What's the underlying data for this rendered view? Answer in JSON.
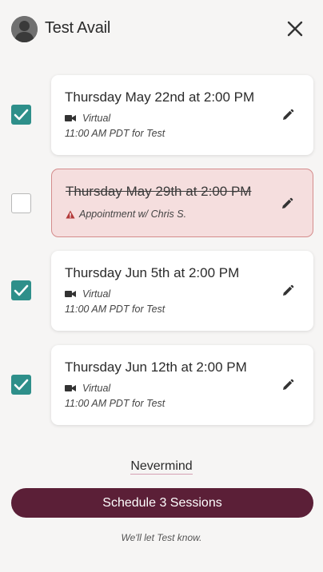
{
  "header": {
    "title": "Test Avail",
    "avatar_icon": "person-silhouette",
    "close_icon": "x"
  },
  "sessions": [
    {
      "title": "Thursday May 22nd at 2:00 PM",
      "checked": true,
      "conflict": false,
      "mode": "Virtual",
      "time_note": "11:00 AM PDT for Test"
    },
    {
      "title": "Thursday May 29th at 2:00 PM",
      "checked": false,
      "conflict": true,
      "conflict_text": "Appointment w/ Chris S."
    },
    {
      "title": "Thursday Jun 5th at 2:00 PM",
      "checked": true,
      "conflict": false,
      "mode": "Virtual",
      "time_note": "11:00 AM PDT for Test"
    },
    {
      "title": "Thursday Jun 12th at 2:00 PM",
      "checked": true,
      "conflict": false,
      "mode": "Virtual",
      "time_note": "11:00 AM PDT for Test"
    }
  ],
  "actions": {
    "nevermind_label": "Nevermind",
    "schedule_label": "Schedule 3 Sessions",
    "footer_note": "We'll let Test know."
  },
  "colors": {
    "accent_teal": "#2e8f8a",
    "primary_button": "#5b1f37",
    "conflict_bg": "#f5dede",
    "conflict_border": "#d48c8c",
    "warning_red": "#b33a3a"
  }
}
